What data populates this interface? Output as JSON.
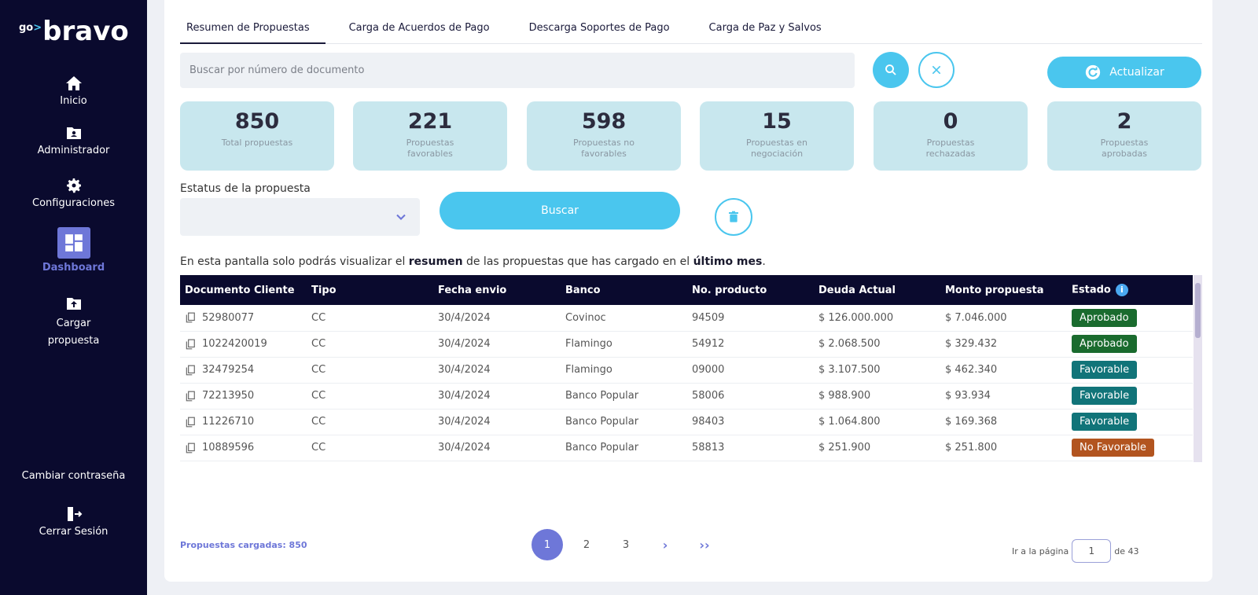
{
  "sidebar": {
    "logo_go": "go",
    "logo_arrow": ">",
    "logo_text": "bravo",
    "items": [
      {
        "label": "Inicio",
        "icon": "home-icon"
      },
      {
        "label": "Administrador",
        "icon": "admin-folder-icon"
      },
      {
        "label": "Configuraciones",
        "icon": "gear-icon"
      },
      {
        "label": "Dashboard",
        "icon": "dashboard-icon",
        "active": true
      },
      {
        "label": "Cargar propuesta",
        "icon": "upload-folder-icon"
      }
    ],
    "change_password": "Cambiar contraseña",
    "logout": "Cerrar Sesión"
  },
  "tabs": [
    {
      "label": "Resumen de Propuestas",
      "active": true
    },
    {
      "label": "Carga de Acuerdos de Pago"
    },
    {
      "label": "Descarga Soportes de Pago"
    },
    {
      "label": "Carga de Paz y Salvos"
    }
  ],
  "search": {
    "placeholder": "Buscar por número de documento",
    "refresh_label": "Actualizar"
  },
  "stats": [
    {
      "value": "850",
      "label": "Total propuestas"
    },
    {
      "value": "221",
      "label": "Propuestas favorables"
    },
    {
      "value": "598",
      "label": "Propuestas no favorables"
    },
    {
      "value": "15",
      "label": "Propuestas en negociación"
    },
    {
      "value": "0",
      "label": "Propuestas rechazadas"
    },
    {
      "value": "2",
      "label": "Propuestas aprobadas"
    }
  ],
  "filter": {
    "label": "Estatus de la propuesta",
    "selected": "",
    "search_button": "Buscar"
  },
  "info": {
    "part1": "En esta pantalla solo podrás visualizar el ",
    "bold1": "resumen",
    "part2": " de las propuestas que has cargado en el ",
    "bold2": "último mes",
    "part3": "."
  },
  "table": {
    "headers": [
      "Documento Cliente",
      "Tipo",
      "Fecha envio",
      "Banco",
      "No. producto",
      "Deuda Actual",
      "Monto propuesta",
      "Estado"
    ],
    "rows": [
      {
        "doc": "52980077",
        "tipo": "CC",
        "fecha": "30/4/2024",
        "banco": "Covinoc",
        "producto": "94509",
        "deuda": "$ 126.000.000",
        "monto": "$ 7.046.000",
        "estado": "Aprobado",
        "estado_color": "#1a6b2e"
      },
      {
        "doc": "1022420019",
        "tipo": "CC",
        "fecha": "30/4/2024",
        "banco": "Flamingo",
        "producto": "54912",
        "deuda": "$ 2.068.500",
        "monto": "$ 329.432",
        "estado": "Aprobado",
        "estado_color": "#1a6b2e"
      },
      {
        "doc": "32479254",
        "tipo": "CC",
        "fecha": "30/4/2024",
        "banco": "Flamingo",
        "producto": "09000",
        "deuda": "$ 3.107.500",
        "monto": "$ 462.340",
        "estado": "Favorable",
        "estado_color": "#117479"
      },
      {
        "doc": "72213950",
        "tipo": "CC",
        "fecha": "30/4/2024",
        "banco": "Banco Popular",
        "producto": "58006",
        "deuda": "$ 988.900",
        "monto": "$ 93.934",
        "estado": "Favorable",
        "estado_color": "#117479"
      },
      {
        "doc": "11226710",
        "tipo": "CC",
        "fecha": "30/4/2024",
        "banco": "Banco Popular",
        "producto": "98403",
        "deuda": "$ 1.064.800",
        "monto": "$ 169.368",
        "estado": "Favorable",
        "estado_color": "#117479"
      },
      {
        "doc": "10889596",
        "tipo": "CC",
        "fecha": "30/4/2024",
        "banco": "Banco Popular",
        "producto": "58813",
        "deuda": "$ 251.900",
        "monto": "$ 251.800",
        "estado": "No Favorable",
        "estado_color": "#b2541f"
      }
    ]
  },
  "footer": {
    "count_label": "Propuestas cargadas: 850",
    "pages": [
      "1",
      "2",
      "3"
    ],
    "current_page": "1",
    "next": "›",
    "last": "››",
    "goto_label": "Ir a la página",
    "goto_value": "1",
    "of_label": "de 43"
  },
  "colors": {
    "sidebar_bg": "#0a0a2e",
    "accent": "#4ac6ee",
    "active": "#6e77d8",
    "stat_bg": "#c8e7ee"
  }
}
